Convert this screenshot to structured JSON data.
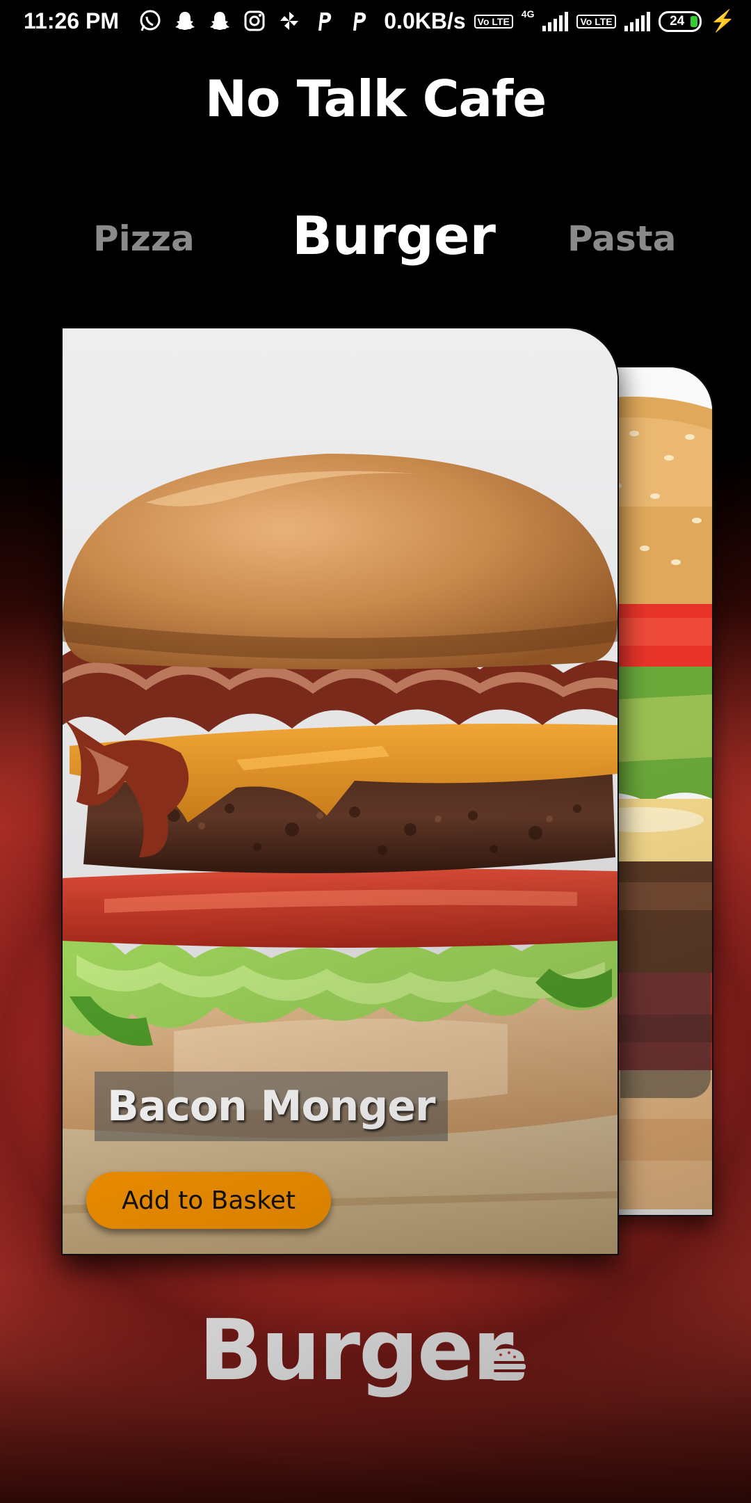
{
  "status_bar": {
    "time": "11:26 PM",
    "network_speed": "0.0KB/s",
    "volte_1": "Vo LTE",
    "network_type": "4G",
    "volte_2": "Vo LTE",
    "battery_level": "24",
    "left_icons": [
      "whatsapp-icon",
      "snapchat-icon",
      "snapchat-icon",
      "instagram-icon",
      "pinwheel-icon",
      "p-app-icon",
      "p-app-icon"
    ]
  },
  "header": {
    "title": "No Talk Cafe"
  },
  "tabs": [
    {
      "label": "Pizza",
      "selected": false
    },
    {
      "label": "Burger",
      "selected": true
    },
    {
      "label": "Pasta",
      "selected": false
    }
  ],
  "cards": {
    "front": {
      "name": "Bacon Monger",
      "button_label": "Add to Basket",
      "image": "bacon-cheeseburger-photo"
    },
    "back": {
      "image": "double-burger-photo"
    }
  },
  "footer": {
    "category": "Burger",
    "icon": "hamburger-icon"
  },
  "colors": {
    "accent_button": "#ff9800",
    "background_red": "#e2433a",
    "tab_inactive": "#8a8a8a"
  }
}
